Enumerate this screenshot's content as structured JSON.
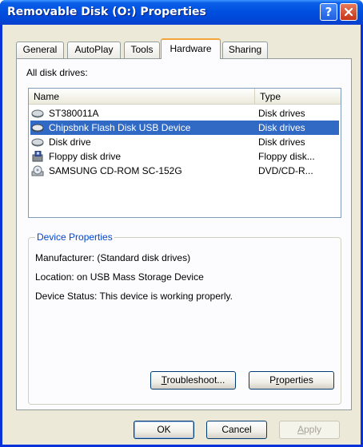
{
  "window": {
    "title": "Removable Disk (O:) Properties",
    "help_glyph": "?"
  },
  "tabs": [
    {
      "label": "General",
      "active": false
    },
    {
      "label": "AutoPlay",
      "active": false
    },
    {
      "label": "Tools",
      "active": false
    },
    {
      "label": "Hardware",
      "active": true
    },
    {
      "label": "Sharing",
      "active": false
    }
  ],
  "hardware": {
    "list_label": "All disk drives:",
    "columns": {
      "name": "Name",
      "type": "Type"
    },
    "rows": [
      {
        "name": "ST380011A",
        "type": "Disk drives",
        "icon": "hard-disk-icon",
        "selected": false
      },
      {
        "name": "Chipsbnk Flash Disk USB Device",
        "type": "Disk drives",
        "icon": "hard-disk-icon",
        "selected": true
      },
      {
        "name": "Disk drive",
        "type": "Disk drives",
        "icon": "hard-disk-icon",
        "selected": false
      },
      {
        "name": "Floppy disk drive",
        "type": "Floppy disk...",
        "icon": "floppy-drive-icon",
        "selected": false
      },
      {
        "name": "SAMSUNG CD-ROM SC-152G",
        "type": "DVD/CD-R...",
        "icon": "cd-drive-icon",
        "selected": false
      }
    ],
    "device_properties": {
      "title": "Device Properties",
      "manufacturer": "Manufacturer: (Standard disk drives)",
      "location": "Location: on USB Mass Storage Device",
      "status": "Device Status: This device is working properly."
    },
    "troubleshoot": {
      "mnemonic": "T",
      "rest": "roubleshoot..."
    },
    "properties": {
      "prefix": "P",
      "mnemonic": "r",
      "rest": "operties"
    }
  },
  "footer": {
    "ok": "OK",
    "cancel": "Cancel",
    "apply_mnemonic": "A",
    "apply_rest": "pply"
  },
  "colors": {
    "titlebar": "#0050e0",
    "selection": "#316ac5",
    "group_title": "#0046d5",
    "active_tab_accent": "#f5a33b"
  }
}
